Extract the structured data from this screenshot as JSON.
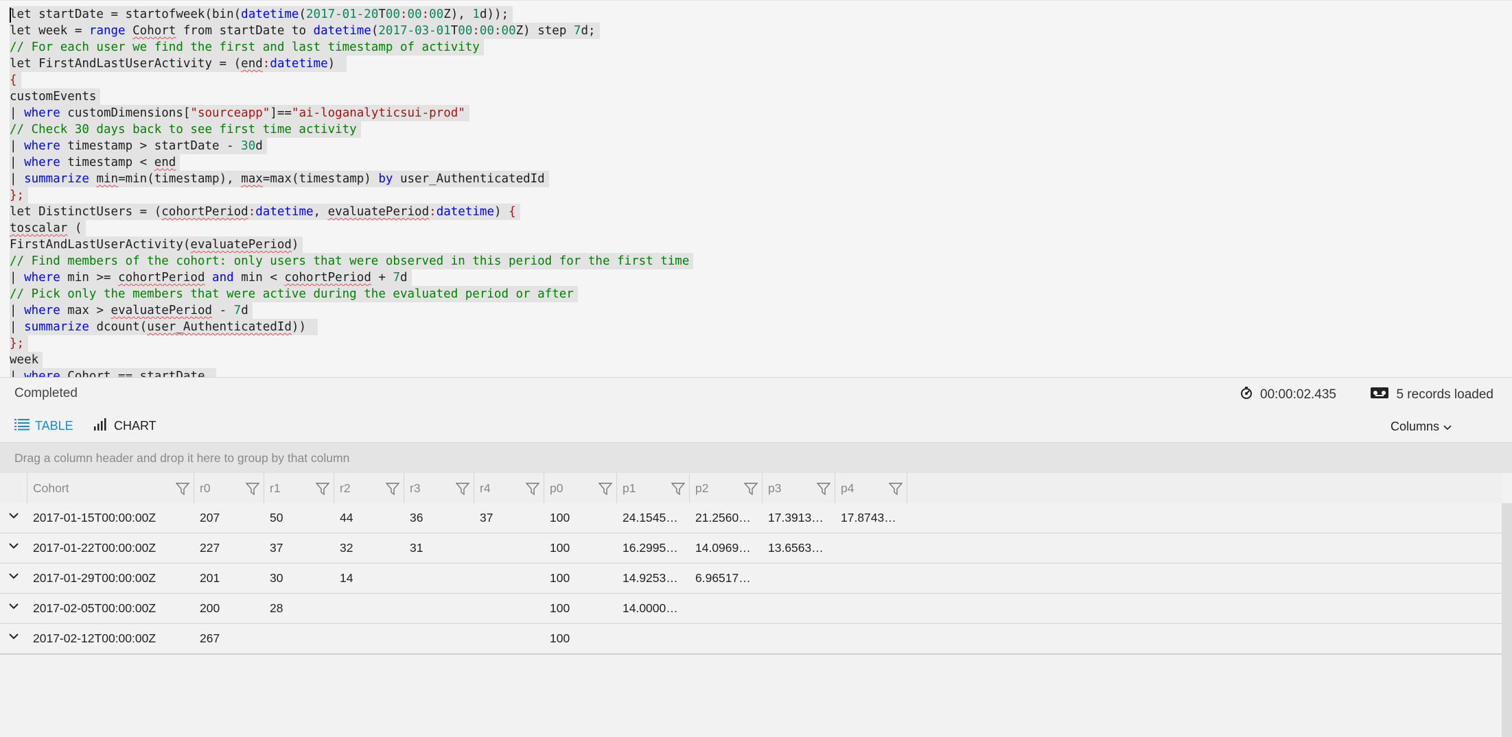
{
  "editor": {
    "lines": [
      [
        [
          "let startDate = startofweek(bin(",
          ""
        ],
        [
          "datetime",
          "kw"
        ],
        [
          "(",
          ""
        ],
        [
          "2017-01-20",
          "num"
        ],
        [
          "T",
          ""
        ],
        [
          "00",
          "num"
        ],
        [
          ":",
          "op"
        ],
        [
          "00",
          "num"
        ],
        [
          ":",
          "op"
        ],
        [
          "00",
          "num"
        ],
        [
          "Z), ",
          ""
        ],
        [
          "1",
          "num"
        ],
        [
          "d));",
          ""
        ]
      ],
      [
        [
          "let week = ",
          ""
        ],
        [
          "range",
          "kw"
        ],
        [
          " ",
          ""
        ],
        [
          "Cohort",
          "sq"
        ],
        [
          " from startDate to ",
          ""
        ],
        [
          "datetime",
          "kw"
        ],
        [
          "(",
          ""
        ],
        [
          "2017-03-01",
          "num"
        ],
        [
          "T",
          ""
        ],
        [
          "00",
          "num"
        ],
        [
          ":",
          "op"
        ],
        [
          "00",
          "num"
        ],
        [
          ":",
          "op"
        ],
        [
          "00",
          "num"
        ],
        [
          "Z) step ",
          ""
        ],
        [
          "7",
          "num"
        ],
        [
          "d;",
          ""
        ]
      ],
      [
        [
          "// For each user we find the first and last timestamp of activity",
          "cm"
        ]
      ],
      [
        [
          "let FirstAndLastUserActivity = (",
          ""
        ],
        [
          "end",
          "sq"
        ],
        [
          ":",
          "op"
        ],
        [
          "datetime",
          "kw"
        ],
        [
          ") ",
          ""
        ]
      ],
      [
        [
          "{",
          "op"
        ]
      ],
      [
        [
          "customEvents",
          ""
        ]
      ],
      [
        [
          "| ",
          ""
        ],
        [
          "where",
          "kw"
        ],
        [
          " customDimensions[",
          ""
        ],
        [
          "\"sourceapp\"",
          "str"
        ],
        [
          "]==",
          ""
        ],
        [
          "\"ai-loganalyticsui-prod\"",
          "str"
        ]
      ],
      [
        [
          "// Check 30 days back to see first time activity",
          "cm"
        ]
      ],
      [
        [
          "| ",
          ""
        ],
        [
          "where",
          "kw"
        ],
        [
          " timestamp > startDate - ",
          ""
        ],
        [
          "30",
          "num"
        ],
        [
          "d",
          ""
        ]
      ],
      [
        [
          "| ",
          ""
        ],
        [
          "where",
          "kw"
        ],
        [
          " timestamp < ",
          ""
        ],
        [
          "end",
          "sq"
        ]
      ],
      [
        [
          "| ",
          ""
        ],
        [
          "summarize",
          "kw"
        ],
        [
          " ",
          ""
        ],
        [
          "min",
          "sq"
        ],
        [
          "=min(timestamp), ",
          ""
        ],
        [
          "max",
          "sq"
        ],
        [
          "=max(timestamp) ",
          ""
        ],
        [
          "by",
          "kw"
        ],
        [
          " user_AuthenticatedId",
          ""
        ]
      ],
      [
        [
          "};",
          "op"
        ]
      ],
      [
        [
          "let DistinctUsers = (",
          ""
        ],
        [
          "cohortPeriod",
          "sq"
        ],
        [
          ":",
          "op"
        ],
        [
          "datetime",
          "kw"
        ],
        [
          ", ",
          ""
        ],
        [
          "evaluatePeriod",
          "sq"
        ],
        [
          ":",
          "op"
        ],
        [
          "datetime",
          "kw"
        ],
        [
          ") ",
          ""
        ],
        [
          "{",
          "op"
        ]
      ],
      [
        [
          "toscalar",
          "sq"
        ],
        [
          " (",
          ""
        ]
      ],
      [
        [
          "FirstAndLastUserActivity(",
          ""
        ],
        [
          "evaluatePeriod",
          "sq"
        ],
        [
          ")",
          ""
        ]
      ],
      [
        [
          "// Find members of the cohort: only users that were observed in this period for the first time",
          "cm"
        ]
      ],
      [
        [
          "| ",
          ""
        ],
        [
          "where",
          "kw"
        ],
        [
          " min >= ",
          ""
        ],
        [
          "cohortPeriod",
          "sq"
        ],
        [
          " ",
          ""
        ],
        [
          "and",
          "kw"
        ],
        [
          " min < ",
          ""
        ],
        [
          "cohortPeriod",
          "sq"
        ],
        [
          " + ",
          ""
        ],
        [
          "7",
          "num"
        ],
        [
          "d",
          ""
        ]
      ],
      [
        [
          "// Pick only the members that were active during the evaluated period or after",
          "cm"
        ]
      ],
      [
        [
          "| ",
          ""
        ],
        [
          "where",
          "kw"
        ],
        [
          " max > ",
          ""
        ],
        [
          "evaluatePeriod",
          "sq"
        ],
        [
          " - ",
          ""
        ],
        [
          "7",
          "num"
        ],
        [
          "d",
          ""
        ]
      ],
      [
        [
          "| ",
          ""
        ],
        [
          "summarize",
          "kw"
        ],
        [
          " dcount(",
          ""
        ],
        [
          "user_AuthenticatedId",
          "sq"
        ],
        [
          ")) ",
          ""
        ]
      ],
      [
        [
          "};",
          "op"
        ]
      ],
      [
        [
          "week",
          ""
        ]
      ],
      [
        [
          "| ",
          ""
        ],
        [
          "where",
          "kw"
        ],
        [
          " Cohort == startDate ",
          ""
        ]
      ]
    ]
  },
  "status": {
    "state": "Completed",
    "elapsed": "00:00:02.435",
    "records": "5 records loaded"
  },
  "tabs": {
    "table_label": "TABLE",
    "chart_label": "CHART",
    "columns_label": "Columns"
  },
  "groupby": {
    "hint": "Drag a column header and drop it here to group by that column"
  },
  "grid": {
    "columns": [
      "Cohort",
      "r0",
      "r1",
      "r2",
      "r3",
      "r4",
      "p0",
      "p1",
      "p2",
      "p3",
      "p4"
    ],
    "rows": [
      [
        "2017-01-15T00:00:00Z",
        "207",
        "50",
        "44",
        "36",
        "37",
        "100",
        "24.1545…",
        "21.2560…",
        "17.3913…",
        "17.8743…"
      ],
      [
        "2017-01-22T00:00:00Z",
        "227",
        "37",
        "32",
        "31",
        "",
        "100",
        "16.2995…",
        "14.0969…",
        "13.6563…",
        ""
      ],
      [
        "2017-01-29T00:00:00Z",
        "201",
        "30",
        "14",
        "",
        "",
        "100",
        "14.9253…",
        "6.96517…",
        "",
        ""
      ],
      [
        "2017-02-05T00:00:00Z",
        "200",
        "28",
        "",
        "",
        "",
        "100",
        "14.0000…",
        "",
        "",
        ""
      ],
      [
        "2017-02-12T00:00:00Z",
        "267",
        "",
        "",
        "",
        "",
        "100",
        "",
        "",
        "",
        ""
      ]
    ]
  },
  "icons": {
    "timer": "stopwatch-icon",
    "records": "records-icon",
    "table": "table-list-icon",
    "chart": "bar-chart-icon",
    "filter": "filter-icon",
    "expand": "chevron-down-icon"
  },
  "colors": {
    "keyword": "#0000ff",
    "comment": "#008000",
    "number": "#098658",
    "string": "#a31515",
    "accent": "#1e88c8"
  }
}
